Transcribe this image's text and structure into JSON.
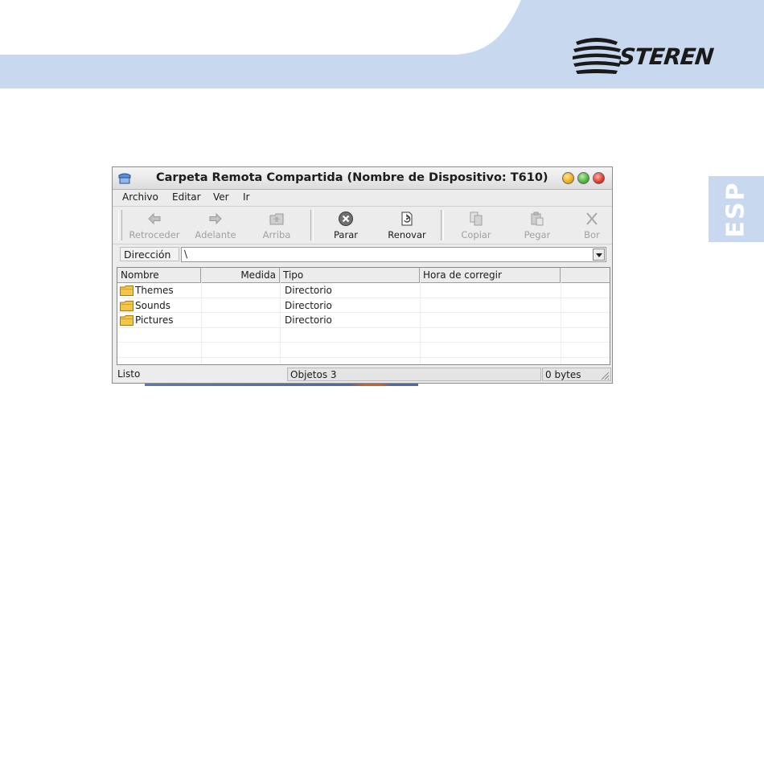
{
  "brand": {
    "logo_text": "STEREN",
    "language_tab": "ESP",
    "colors": {
      "banner": "#c7d8ef",
      "logo": "#1a1a1a",
      "tab": "#c7d8ef"
    }
  },
  "window": {
    "title": "Carpeta Remota Compartida (Nombre de Dispositivo: T610)",
    "app_icon": "folder-share-icon",
    "menu": [
      "Archivo",
      "Editar",
      "Ver",
      "Ir"
    ],
    "toolbar": [
      {
        "label": "Retroceder",
        "icon": "arrow-left-icon",
        "enabled": false
      },
      {
        "label": "Adelante",
        "icon": "arrow-right-icon",
        "enabled": false
      },
      {
        "label": "Arriba",
        "icon": "folder-up-icon",
        "enabled": false
      },
      {
        "label": "Parar",
        "icon": "stop-icon",
        "enabled": true
      },
      {
        "label": "Renovar",
        "icon": "refresh-icon",
        "enabled": true
      },
      {
        "label": "Copiar",
        "icon": "copy-icon",
        "enabled": false
      },
      {
        "label": "Pegar",
        "icon": "paste-icon",
        "enabled": false
      },
      {
        "label": "Bor",
        "icon": "delete-icon",
        "enabled": false
      }
    ],
    "address": {
      "label": "Dirección",
      "value": "\\"
    },
    "columns": [
      "Nombre",
      "Medida",
      "Tipo",
      "Hora de corregir"
    ],
    "rows": [
      {
        "name": "Themes",
        "size": "",
        "type": "Directorio",
        "modified": ""
      },
      {
        "name": "Sounds",
        "size": "",
        "type": "Directorio",
        "modified": ""
      },
      {
        "name": "Pictures",
        "size": "",
        "type": "Directorio",
        "modified": ""
      }
    ],
    "status": {
      "state": "Listo",
      "objects": "Objetos 3",
      "bytes": "0 bytes"
    }
  }
}
